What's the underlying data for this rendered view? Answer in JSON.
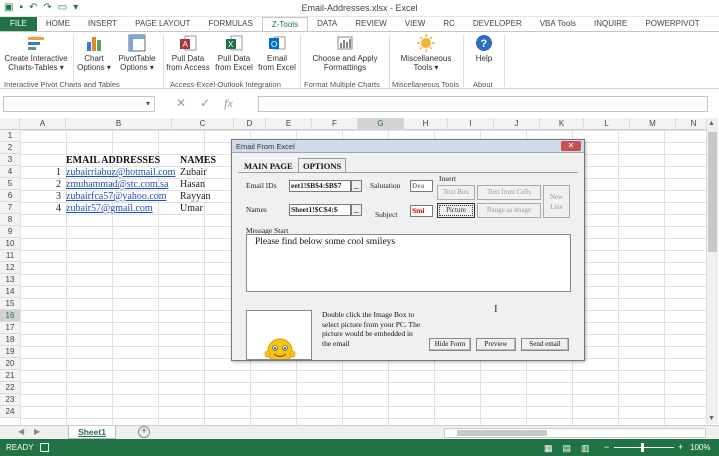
{
  "window": {
    "title": "Email-Addresses.xlsx - Excel"
  },
  "tabs": [
    "FILE",
    "HOME",
    "INSERT",
    "PAGE LAYOUT",
    "FORMULAS",
    "Z-Tools",
    "DATA",
    "REVIEW",
    "VIEW",
    "RC",
    "DEVELOPER",
    "VBA Tools",
    "INQUIRE",
    "POWERPIVOT"
  ],
  "ribbon": {
    "buttons": [
      {
        "line1": "Create Interactive",
        "line2": "Charts-Tables ▾",
        "icon": "interactive-charts-icon"
      },
      {
        "line1": "Chart",
        "line2": "Options ▾",
        "icon": "chart-options-icon"
      },
      {
        "line1": "PivotTable",
        "line2": "Options ▾",
        "icon": "pivottable-icon"
      },
      {
        "line1": "Pull Data",
        "line2": "from Access",
        "icon": "access-icon"
      },
      {
        "line1": "Pull Data",
        "line2": "from Excel",
        "icon": "excel-icon"
      },
      {
        "line1": "Email",
        "line2": "from Excel",
        "icon": "outlook-icon"
      },
      {
        "line1": "Choose and Apply",
        "line2": "Formattings",
        "icon": "formatting-icon"
      },
      {
        "line1": "Miscellaneous",
        "line2": "Tools ▾",
        "icon": "misc-tools-icon"
      },
      {
        "line1": "Help",
        "line2": "",
        "icon": "help-icon"
      }
    ],
    "groups": [
      "Interactive Pivot Charts and Tables",
      "Access-Excel-Outlook Integration",
      "Format Multiple Charts",
      "Miscellaneous Tools",
      "About"
    ]
  },
  "formula_bar": {
    "name_box": "",
    "formula": "",
    "fx": "fx"
  },
  "columns": [
    "A",
    "B",
    "C",
    "D",
    "E",
    "F",
    "G",
    "H",
    "I",
    "J",
    "K",
    "L",
    "M",
    "N"
  ],
  "rows": [
    "1",
    "2",
    "3",
    "4",
    "5",
    "6",
    "7",
    "8",
    "9",
    "10",
    "11",
    "12",
    "13",
    "14",
    "15",
    "16",
    "17",
    "18",
    "19",
    "20",
    "21",
    "22",
    "23",
    "24"
  ],
  "selected_row": "16",
  "selected_col": "G",
  "sheet_data": {
    "header_email": "EMAIL ADDRESSES",
    "header_name": "NAMES",
    "rows": [
      {
        "n": "1",
        "email": "zubairriabuz@hotmail.com",
        "name": "Zubair"
      },
      {
        "n": "2",
        "email": "zmuhammad@stc.com.sa",
        "name": "Hasan"
      },
      {
        "n": "3",
        "email": "zubairfca57@yahoo.com",
        "name": "Rayyan"
      },
      {
        "n": "4",
        "email": "zubair57@gmail.com",
        "name": "Umar"
      }
    ]
  },
  "dialog": {
    "title": "Email From Excel",
    "tab_main": "MAIN PAGE",
    "tab_options": "OPTIONS",
    "email_ids_label": "Email IDs",
    "email_ids_value": "eet1!$B$4:$B$7",
    "names_label": "Names",
    "names_value": "Sheet1!$C$4:$",
    "salutation_label": "Salutation",
    "salutation_value": "Dea",
    "subject_label": "Subject",
    "subject_value": "Smi",
    "insert_label": "Insert",
    "btn_text_box": "Text Box",
    "btn_text_from_cells": "Text from Cells",
    "btn_picture": "Picture",
    "btn_range_as_image": "Range as image",
    "btn_new_line": "New Line",
    "message_label": "Message Start",
    "message_text": "Please find below some cool smileys",
    "image_hint": "Double click the Image Box to select picture from your PC. The picture would be embedded in the email",
    "btn_hide_form": "Hide Form",
    "btn_preview": "Preview",
    "btn_send_email": "Send email"
  },
  "sheet_tabs": [
    "Sheet1"
  ],
  "status": {
    "left": "READY",
    "zoom": "100%"
  }
}
